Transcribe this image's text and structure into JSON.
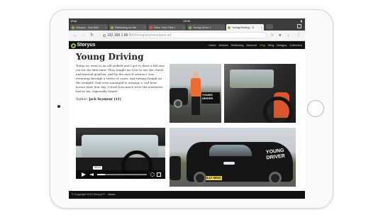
{
  "status_bar": {
    "left": "iPad",
    "time": "09:34",
    "battery": ""
  },
  "tabs": [
    {
      "label": "Storyus - Zoe Bell"
    },
    {
      "label": "Reflecting on the"
    },
    {
      "label": "Save Your Past L"
    },
    {
      "label": "Young Driver I"
    },
    {
      "label": "Young Driving - S"
    }
  ],
  "address_bar": {
    "host": "192.168.1.68",
    "path": ":8000/vlog/seymour/jack-sd"
  },
  "site": {
    "logo": "Storyus",
    "nav": [
      "Home",
      "Articles",
      "Reflecting",
      "Moment",
      "Vlog",
      "Blog",
      "Designs",
      "Collection"
    ],
    "active_nav": "Vlog"
  },
  "article": {
    "title": "Young Driving",
    "body": "Today we went to an old airfield and I got to drive a full size car for the first time! They taught me how to use the clutch and manual gearbox, and by the end of session I was reversing through a series of cones, and hitting 60mph on the straight! Dad even managed to arrange a 2nd hour lesson later that day. I loved how much trust the instructor had in me, especially Stuart.",
    "author_label": "Author:",
    "author_name": "Jack Seymour (11)"
  },
  "photos": {
    "car_side_text": "YOUNG DRIVER",
    "car_plate": "DL17 WXO",
    "car_door_text": "YOUNG DRIVER"
  },
  "video": {
    "time": "00:13",
    "progress": 0.15
  },
  "footer": {
    "copyright": "© Copyright 2019 Storyus™",
    "link": "About"
  },
  "colors": {
    "accent": "#8dc63f",
    "header_bg": "#111111"
  }
}
